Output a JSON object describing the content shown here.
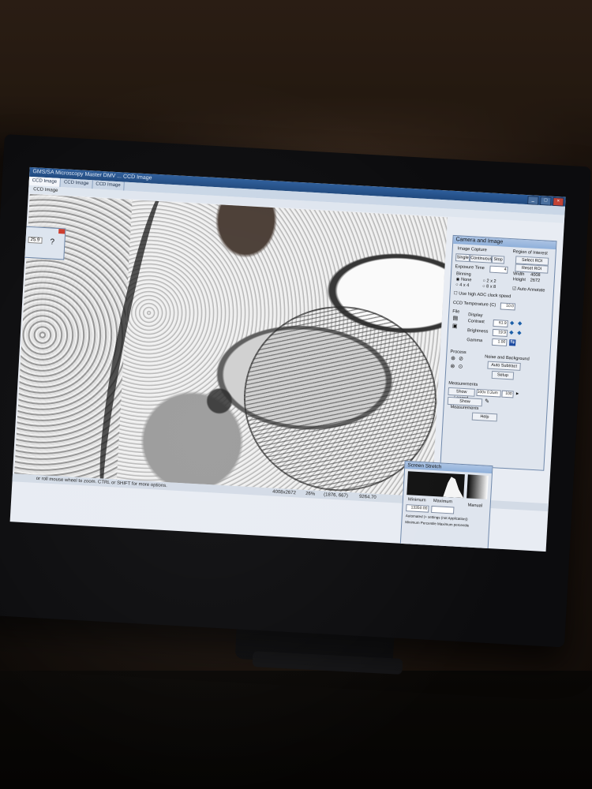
{
  "window": {
    "title": "GMS/SA Microscopy Master DMV ... CCD Image",
    "controls": [
      "_",
      "□",
      "×"
    ]
  },
  "tabs": [
    {
      "label": "CCD Image"
    },
    {
      "label": "CCD Image"
    },
    {
      "label": "CCD Image"
    }
  ],
  "document": {
    "title": "CCD Image"
  },
  "floating_tool": {
    "zoom": "25.9",
    "help_icon": "help-cursor-icon"
  },
  "status_bar": {
    "hint": "or roll mouse wheel to zoom. CTRL or SHIFT for more options.",
    "dimensions": "4008x2672",
    "zoom": "26%",
    "coords": "(1876, 667)",
    "value": "9264.70"
  },
  "camera_panel": {
    "title": "Camera and Image",
    "capture_label": "Image Capture",
    "single": "Single",
    "continuous": "Continuous",
    "stop": "Stop",
    "roi_label": "Region of Interest",
    "select_roi": "Select ROI",
    "reset_roi": "Reset ROI",
    "width_label": "Width",
    "width_value": "4008",
    "height_label": "Height",
    "height_value": "2672",
    "exposure_label": "Exposure Time",
    "exposure_value": "4",
    "binning_label": "Binning",
    "bin_none": "None",
    "bin_2": "2 x 2",
    "bin_4": "4 x 4",
    "bin_8": "8 x 8",
    "auto_annotate": "Auto Annotate",
    "high_adc": "Use high ADC clock speed",
    "ccd_temp_label": "CCD Temperature (C)",
    "ccd_temp_value": "10.0",
    "file_label": "File",
    "display_label": "Display",
    "contrast_label": "Contrast",
    "contrast_value": "61.9",
    "brightness_label": "Brightness",
    "brightness_value": "19.9",
    "gamma_label": "Gamma",
    "gamma_value": "1.00",
    "process_label": "Process",
    "noise_bg": "Noise and Background",
    "auto_subtract": "Auto Subtract",
    "setup": "Setup",
    "measurements_label": "Measurements",
    "show_legend": "Show Legend",
    "legend_select": "100x 0.2um",
    "legend_num": "100",
    "show_measurements": "Show Measurements",
    "help": "Help"
  },
  "stretch_panel": {
    "title": "Screen Stretch",
    "minimum_label": "Minimum",
    "maximum_label": "Maximum",
    "manual_label": "Manual",
    "min_value": "13350.00",
    "max_value": "",
    "auto_text": "Automated (+ settings (not Application))",
    "percentile_label": "Minimum Percentile    Maximum percentile"
  }
}
